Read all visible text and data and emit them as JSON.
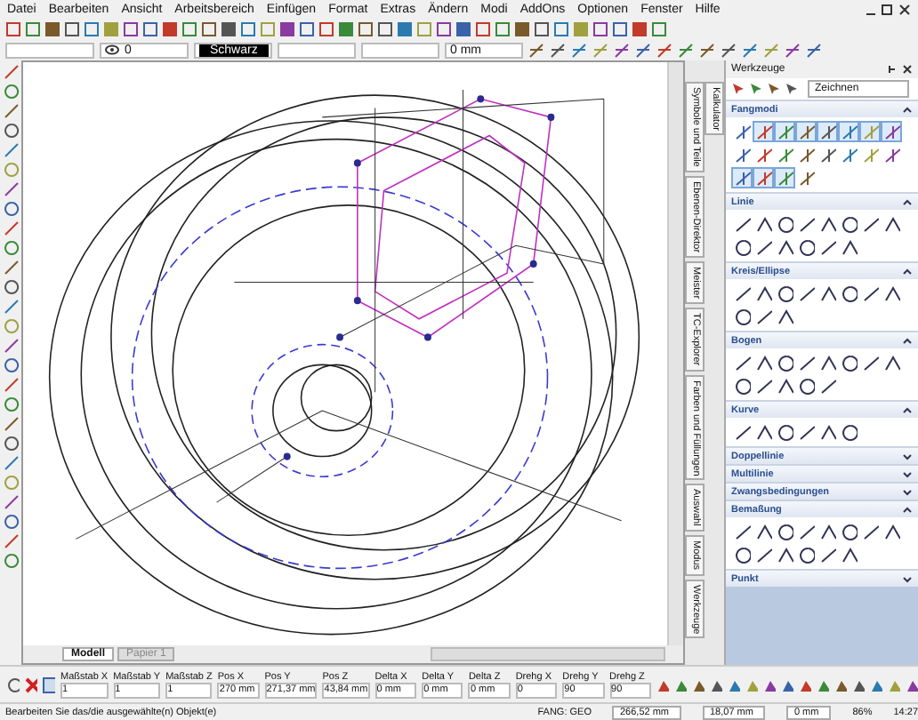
{
  "menu": [
    "Datei",
    "Bearbeiten",
    "Ansicht",
    "Arbeitsbereich",
    "Einfügen",
    "Format",
    "Extras",
    "Ändern",
    "Modi",
    "AddOns",
    "Optionen",
    "Fenster",
    "Hilfe"
  ],
  "properties": {
    "layer": "0",
    "pen": "Schwarz",
    "width": "0 mm"
  },
  "drawing_tabs": [
    {
      "label": "Modell",
      "selected": true
    },
    {
      "label": "Papier 1",
      "selected": false
    }
  ],
  "side_tabs": [
    "Symbole und Teile",
    "Ebenen-Direktor",
    "Meister",
    "TC-Explorer",
    "Farben und Füllungen",
    "Auswahl",
    "Modus",
    "Werkzeuge",
    "Kalkulator"
  ],
  "panel": {
    "title": "Werkzeuge",
    "mode": "Zeichnen",
    "sections": [
      {
        "title": "Fangmodi",
        "expanded": true,
        "snaps": [
          {
            "selected": false
          },
          {
            "selected": true
          },
          {
            "selected": true
          },
          {
            "selected": true
          },
          {
            "selected": true
          },
          {
            "selected": true
          },
          {
            "selected": true
          },
          {
            "selected": true
          },
          {
            "selected": false
          },
          {
            "selected": false
          },
          {
            "selected": false
          },
          {
            "selected": false
          },
          {
            "selected": false
          },
          {
            "selected": false
          },
          {
            "selected": false
          },
          {
            "selected": false
          },
          {
            "selected": true
          },
          {
            "selected": true
          },
          {
            "selected": true
          },
          {
            "selected": false
          }
        ]
      },
      {
        "title": "Linie",
        "expanded": true
      },
      {
        "title": "Kreis/Ellipse",
        "expanded": true
      },
      {
        "title": "Bogen",
        "expanded": true
      },
      {
        "title": "Kurve",
        "expanded": true
      },
      {
        "title": "Doppellinie",
        "expanded": false
      },
      {
        "title": "Multilinie",
        "expanded": false
      },
      {
        "title": "Zwangsbedingungen",
        "expanded": false
      },
      {
        "title": "Bemaßung",
        "expanded": true
      },
      {
        "title": "Punkt",
        "expanded": false
      }
    ]
  },
  "parameters": [
    {
      "label": "Maßstab X",
      "value": "1"
    },
    {
      "label": "Maßstab Y",
      "value": "1"
    },
    {
      "label": "Maßstab Z",
      "value": "1"
    },
    {
      "label": "Pos X",
      "value": "270 mm"
    },
    {
      "label": "Pos Y",
      "value": "271,37 mm"
    },
    {
      "label": "Pos Z",
      "value": "43,84 mm"
    },
    {
      "label": "Delta X",
      "value": "0 mm"
    },
    {
      "label": "Delta Y",
      "value": "0 mm"
    },
    {
      "label": "Delta Z",
      "value": "0 mm"
    },
    {
      "label": "Drehg X",
      "value": "0"
    },
    {
      "label": "Drehg Y",
      "value": "90"
    },
    {
      "label": "Drehg Z",
      "value": "90"
    }
  ],
  "status_bar": {
    "message": "Bearbeiten Sie das/die ausgewählte(n) Objekt(e)",
    "snap": "FANG: GEO",
    "x": "266,52 mm",
    "y": "18,07 mm",
    "z": "0 mm",
    "zoom": "86%",
    "time": "14:27"
  }
}
